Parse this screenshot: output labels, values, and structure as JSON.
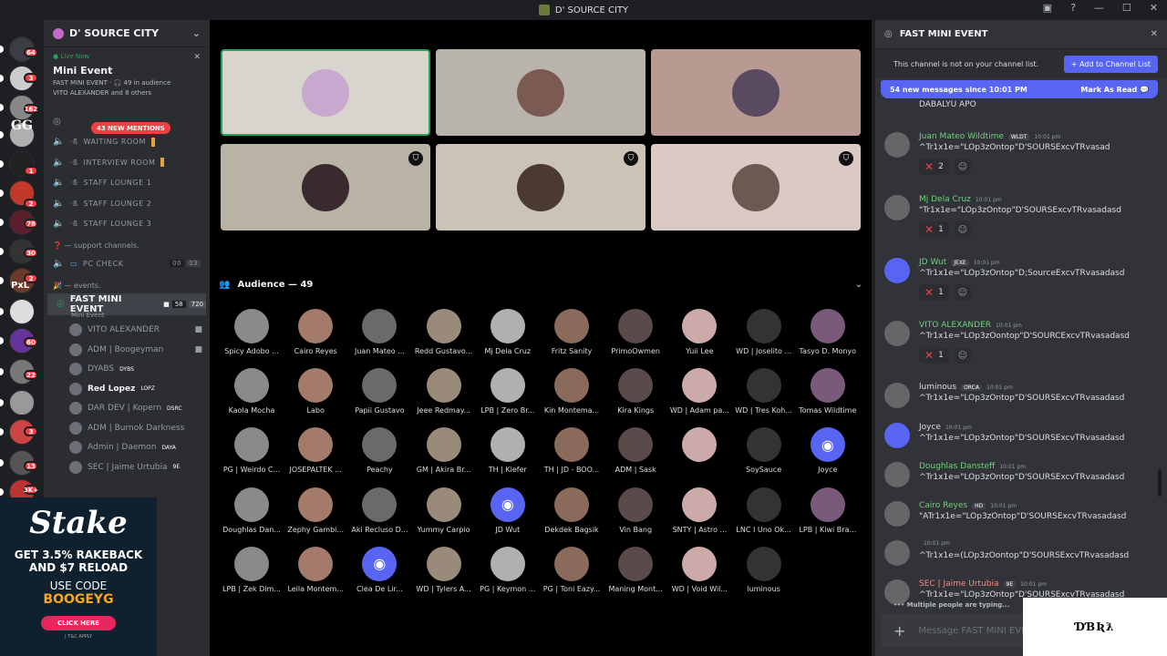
{
  "window": {
    "title": "D' SOURCE CITY"
  },
  "guilds": {
    "badges": [
      "64",
      "3",
      "162",
      "1",
      "2",
      "78",
      "30",
      "2",
      "60",
      "22",
      "3",
      "13",
      "3K+"
    ],
    "pxl_label": "PxL",
    "gg_label": "GG"
  },
  "channels": {
    "server_name": "D' SOURCE CITY",
    "live_label": "Live Now",
    "event_title": "Mini Event",
    "event_meta": "FAST MINI EVENT · 🎧 49 in audience",
    "event_people": "VITO ALEXANDER and 8 others",
    "mentions": "43 NEW MENTIONS",
    "voice": [
      {
        "name": "WAITING ROOM"
      },
      {
        "name": "INTERVIEW ROOM"
      },
      {
        "name": "STAFF LOUNGE 1"
      },
      {
        "name": "STAFF LOUNGE 2"
      },
      {
        "name": "STAFF LOUNGE 3"
      }
    ],
    "support_cat": "— support channels.",
    "pc_check": "PC CHECK",
    "pc_count_a": "00",
    "pc_count_b": "03",
    "events_cat": "— events.",
    "active": {
      "name": "FAST MINI EVENT",
      "count_a": "58",
      "count_b": "720",
      "sub": "Mini Event"
    },
    "users": [
      "VITO ALEXANDER",
      "ADM | Boogeyman",
      "DYABS",
      "Red Lopez",
      "DAR DEV | Kopern",
      "ADM | Burnok Darkness",
      "Admin | Daemon",
      "SEC | Jaime Urtubia"
    ],
    "user_tags": [
      "",
      "",
      "DYBS",
      "LOPZ",
      "DSRC",
      "",
      "DAYA",
      "9E"
    ]
  },
  "ad": {
    "logo": "Stake",
    "line1": "GET 3.5% RAKEBACK",
    "line2": "AND $7 RELOAD",
    "use_code": "USE CODE",
    "code": "BOOGEYG",
    "button": "CLICK HERE",
    "tc": "| T&C APPLY"
  },
  "stage": {
    "audience_title": "Audience — 49",
    "tiles": [
      {
        "bg": "#d8d5cf",
        "av": "#c8a8cf",
        "speaking": true,
        "shield": false
      },
      {
        "bg": "#b9b4ab",
        "av": "#7a5a52",
        "speaking": false,
        "shield": false
      },
      {
        "bg": "#b99a93",
        "av": "#5a4a60",
        "speaking": false,
        "shield": false
      },
      {
        "bg": "#b9b3a5",
        "av": "#3a2a30",
        "speaking": false,
        "shield": true
      },
      {
        "bg": "#cac3b6",
        "av": "#4a3a32",
        "speaking": false,
        "shield": true
      },
      {
        "bg": "#dac9c4",
        "av": "#6a5a52",
        "speaking": false,
        "shield": true
      }
    ],
    "audience": [
      "Spicy Adobo ...",
      "Cairo Reyes",
      "Juan Mateo ...",
      "Redd Gustavo...",
      "Mj Dela Cruz",
      "Fritz Sanity",
      "PrimoOwmen",
      "Yuii Lee",
      "WD | Joselito ...",
      "Tasyo D. Monyo",
      "Kaola Mocha",
      "Labo",
      "Papii Gustavo",
      "Jeee Redmay...",
      "LPB | Zero Br...",
      "Kin Montema...",
      "Kira Kings",
      "WD | Adam pa...",
      "WD | Tres Koh...",
      "Tomas Wildtime",
      "PG | Weirdo C...",
      "JOSEPALTEK ...",
      "Peachy",
      "GM | Akira Br...",
      "TH | Kiefer",
      "TH | JD - BOO...",
      "ADM | Sask",
      "",
      "SoySauce",
      "Joyce",
      "Doughlas Dan...",
      "Zephy Gambi...",
      "Aki Recluso D...",
      "Yummy Carpio",
      "JD Wut",
      "Dekdek Bagsik",
      "Vin Bang",
      "SNTY | Astro ...",
      "LNC I Uno Ok...",
      "LPB | Kiwi Bra...",
      "LPB | Zek Dim...",
      "Leila Montem...",
      "Clea De Lir...",
      "WD | Tylers A...",
      "PG | Keymon ...",
      "PG | Toni Eazy...",
      "Maning Mont...",
      "WD | Void Wil...",
      "luminous"
    ]
  },
  "chat": {
    "channel": "FAST MINI EVENT",
    "notice": "This channel is not on your channel list.",
    "add_button": "Add to Channel List",
    "new_messages": "54 new messages since 10:01 PM",
    "mark_read": "Mark As Read",
    "top_line": "DABALYU APO",
    "messages": [
      {
        "author": "Juan Mateo Wildtime",
        "tag": "WLDT",
        "time": "10:01 pm",
        "text": "^Tr1x1e=\"LOp3zOntop\"D'SOURSExcvTRvasad",
        "react": "2",
        "color": "#6fd27a"
      },
      {
        "author": "Mj Dela Cruz",
        "tag": "",
        "time": "10:01 pm",
        "text": "\"Tr1x1e=\"LOp3zOntop\"D'SOURSExcvTRvasadasd",
        "react": "1",
        "color": "#6fd27a"
      },
      {
        "author": "JD Wut",
        "tag": "JEXE",
        "time": "10:01 pm",
        "text": "^Tr1x1e=\"LOp3zOntop\"D;SourceExcvTRvasadasd",
        "react": "1",
        "color": "#6fd27a"
      },
      {
        "author": "VITO ALEXANDER",
        "tag": "",
        "time": "10:01 pm",
        "text": "^Tr1x1e=\"LOp3zOontop\"D'SOURCExcvTRvasadasd",
        "react": "1",
        "color": "#6fd27a"
      },
      {
        "author": "luminous",
        "tag": "ORCA",
        "time": "10:01 pm",
        "text": "^Tr1x1e=\"LOp3zOntop\"D'SOURSExcvTRvasadasd",
        "react": "",
        "color": "#dbdee1"
      },
      {
        "author": "Joyce",
        "tag": "",
        "time": "10:01 pm",
        "text": "^Tr1x1e=\"LOp3zOntop\"D'SOURSExcvTRvasadasd",
        "react": "",
        "color": "#dbdee1"
      },
      {
        "author": "Doughlas Dansteff",
        "tag": "",
        "time": "10:01 pm",
        "text": "^Tr1x1e=\"LOp3zOntop\"D'SOURSExcvTRvasadasd",
        "react": "",
        "color": "#6fd27a"
      },
      {
        "author": "Cairo Reyes",
        "tag": "HD",
        "time": "10:01 pm",
        "text": "\"ATr1x1e=\"LOp3zOntop\"D'SOURSExcvTRvasadasd",
        "react": "",
        "color": "#6fd27a"
      },
      {
        "author": "",
        "tag": "",
        "time": "10:01 pm",
        "text": "^Tr1x1e=(LOp3zOontop\"D'SOURSExcvTRvasadasd",
        "react": "",
        "color": "#dbdee1"
      },
      {
        "author": "SEC | Jaime Urtubia",
        "tag": "9E",
        "time": "10:01 pm",
        "text": "^Tr1x1e=\"LOp3zOntop\"D'SOURSExcvTRvasadasd",
        "react": "",
        "color": "#f28b82"
      }
    ],
    "typing": "Multiple people are typing...",
    "composer_placeholder": "Message FAST MINI EVENT"
  },
  "overlay": {
    "logo_text": "ƊƁƦƛ"
  }
}
